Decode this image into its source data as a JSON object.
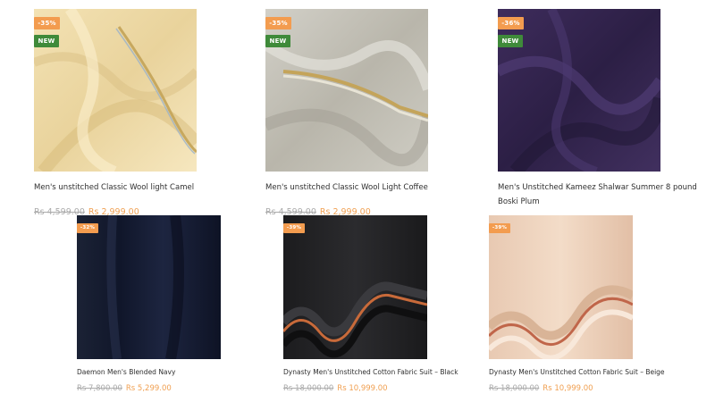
{
  "products": [
    {
      "title": "Men's unstitched Classic Wool light Camel",
      "old_price": "Rs 4,599.00",
      "price": "Rs 2,999.00",
      "discount": "-35%",
      "new_label": "NEW",
      "image_icon": "camel-fabric-image"
    },
    {
      "title": "Men's unstitched Classic Wool Light Coffee",
      "old_price": "Rs 4,599.00",
      "price": "Rs 2,999.00",
      "discount": "-35%",
      "new_label": "NEW",
      "image_icon": "coffee-fabric-image"
    },
    {
      "title": "Men's Unstitched Kameez Shalwar Summer 8 pound Boski Plum",
      "old_price": "",
      "price": "",
      "discount": "-36%",
      "new_label": "NEW",
      "image_icon": "plum-fabric-image"
    },
    {
      "title": "Daemon Men's Blended Navy",
      "old_price": "Rs 7,800.00",
      "price": "Rs 5,299.00",
      "discount": "-32%",
      "image_icon": "navy-fabric-image"
    },
    {
      "title": "Dynasty Men's Unstitched Cotton Fabric Suit – Black",
      "old_price": "Rs 18,000.00",
      "price": "Rs 10,999.00",
      "discount": "-39%",
      "image_icon": "black-fabric-image"
    },
    {
      "title": "Dynasty Men's Unstitched Cotton Fabric Suit – Beige",
      "old_price": "Rs 18,000.00",
      "price": "Rs 10,999.00",
      "discount": "-39%",
      "image_icon": "beige-fabric-image"
    }
  ],
  "colors": {
    "sale_badge": "#f39c4f",
    "new_badge": "#3f8a3a",
    "price": "#f0a052",
    "old_price": "#aaaaaa"
  }
}
